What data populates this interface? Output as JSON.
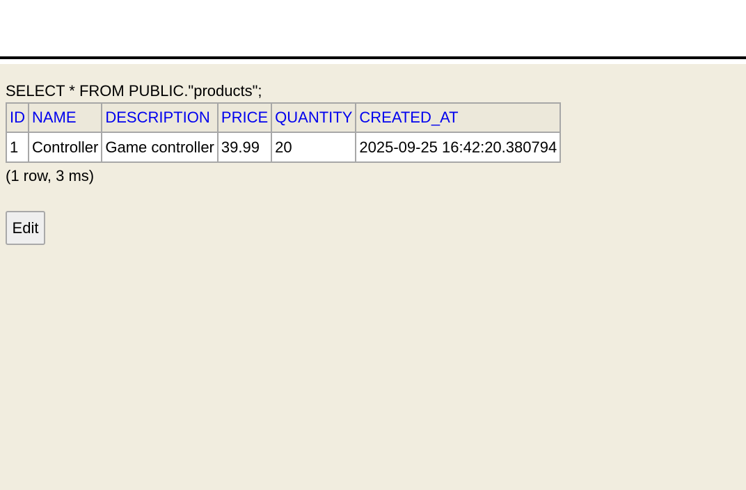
{
  "result": {
    "query": "SELECT * FROM PUBLIC.\"products\";",
    "columns": [
      "ID",
      "NAME",
      "DESCRIPTION",
      "PRICE",
      "QUANTITY",
      "CREATED_AT"
    ],
    "rows": [
      [
        "1",
        "Controller",
        "Game controller",
        "39.99",
        "20",
        "2025-09-25 16:42:20.380794"
      ]
    ],
    "row_count_text": "(1 row, 3 ms)"
  },
  "actions": {
    "edit_label": "Edit"
  },
  "colors": {
    "panel_background": "#f1eddf",
    "header_link": "#0000ee",
    "splitter": "#000000"
  }
}
